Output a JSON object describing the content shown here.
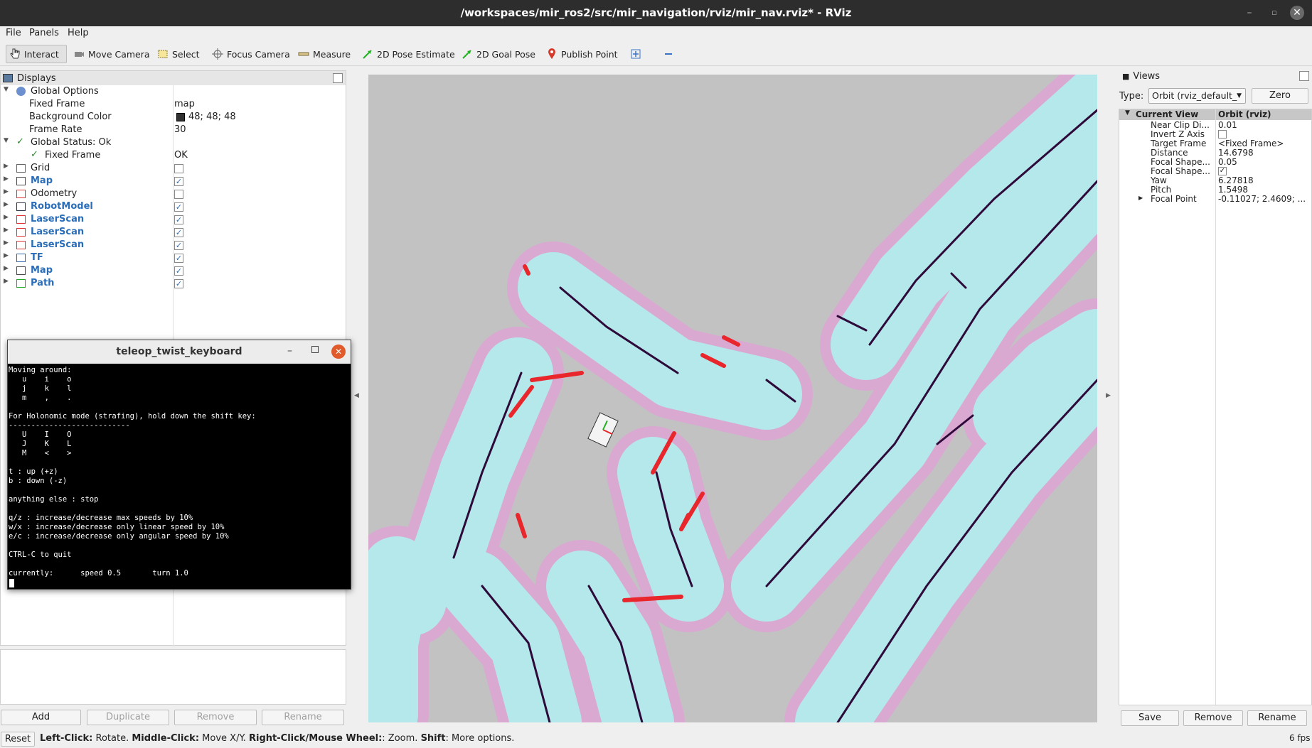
{
  "window": {
    "title": "/workspaces/mir_ros2/src/mir_navigation/rviz/mir_nav.rviz* - RViz"
  },
  "menu": {
    "file": "File",
    "panels": "Panels",
    "help": "Help"
  },
  "toolbar": {
    "interact": "Interact",
    "move_camera": "Move Camera",
    "select": "Select",
    "focus_camera": "Focus Camera",
    "measure": "Measure",
    "pose_estimate": "2D Pose Estimate",
    "goal_pose": "2D Goal Pose",
    "publish_point": "Publish Point"
  },
  "displays": {
    "title": "Displays",
    "global_options": "Global Options",
    "fixed_frame_label": "Fixed Frame",
    "fixed_frame_value": "map",
    "bg_color_label": "Background Color",
    "bg_color_value": "48; 48; 48",
    "frame_rate_label": "Frame Rate",
    "frame_rate_value": "30",
    "global_status": "Global Status: Ok",
    "status_fixed_frame": "Fixed Frame",
    "status_fixed_frame_value": "OK",
    "items": [
      {
        "label": "Grid",
        "checked": false,
        "highlight": false
      },
      {
        "label": "Map",
        "checked": true,
        "highlight": true
      },
      {
        "label": "Odometry",
        "checked": false,
        "highlight": false
      },
      {
        "label": "RobotModel",
        "checked": true,
        "highlight": true
      },
      {
        "label": "LaserScan",
        "checked": true,
        "highlight": true
      },
      {
        "label": "LaserScan",
        "checked": true,
        "highlight": true
      },
      {
        "label": "LaserScan",
        "checked": true,
        "highlight": true
      },
      {
        "label": "TF",
        "checked": true,
        "highlight": true
      },
      {
        "label": "Map",
        "checked": true,
        "highlight": true
      },
      {
        "label": "Path",
        "checked": true,
        "highlight": true
      }
    ],
    "buttons": {
      "add": "Add",
      "duplicate": "Duplicate",
      "remove": "Remove",
      "rename": "Rename"
    }
  },
  "terminal": {
    "title": "teleop_twist_keyboard",
    "text": "Moving around:\n   u    i    o\n   j    k    l\n   m    ,    .\n\nFor Holonomic mode (strafing), hold down the shift key:\n---------------------------\n   U    I    O\n   J    K    L\n   M    <    >\n\nt : up (+z)\nb : down (-z)\n\nanything else : stop\n\nq/z : increase/decrease max speeds by 10%\nw/x : increase/decrease only linear speed by 10%\ne/c : increase/decrease only angular speed by 10%\n\nCTRL-C to quit\n\ncurrently:      speed 0.5       turn 1.0"
  },
  "views": {
    "title": "Views",
    "type_label": "Type:",
    "type_value": "Orbit (rviz_default_",
    "zero": "Zero",
    "current_view": "Current View",
    "current_view_value": "Orbit (rviz)",
    "props": [
      {
        "label": "Near Clip Di...",
        "value": "0.01"
      },
      {
        "label": "Invert Z Axis",
        "value": ""
      },
      {
        "label": "Target Frame",
        "value": "<Fixed Frame>"
      },
      {
        "label": "Distance",
        "value": "14.6798"
      },
      {
        "label": "Focal Shape...",
        "value": "0.05"
      },
      {
        "label": "Focal Shape...",
        "value": ""
      },
      {
        "label": "Yaw",
        "value": "6.27818"
      },
      {
        "label": "Pitch",
        "value": "1.5498"
      },
      {
        "label": "Focal Point",
        "value": "-0.11027; 2.4609; ..."
      }
    ],
    "buttons": {
      "save": "Save",
      "remove": "Remove",
      "rename": "Rename"
    }
  },
  "status": {
    "reset": "Reset",
    "left_click": "Left-Click:",
    "left_click_action": " Rotate. ",
    "middle_click": "Middle-Click:",
    "middle_click_action": " Move X/Y. ",
    "right_click": "Right-Click/Mouse Wheel:",
    "right_click_action": ": Zoom. ",
    "shift": "Shift",
    "shift_action": ": More options.",
    "fps": "6 fps"
  },
  "colors": {
    "free_space": "#c2c2c2",
    "inflation": "#b5e8ea",
    "inflation_edge": "#d9a9d2",
    "obstacle": "#2d0a3a",
    "laser": "#e8262b"
  }
}
